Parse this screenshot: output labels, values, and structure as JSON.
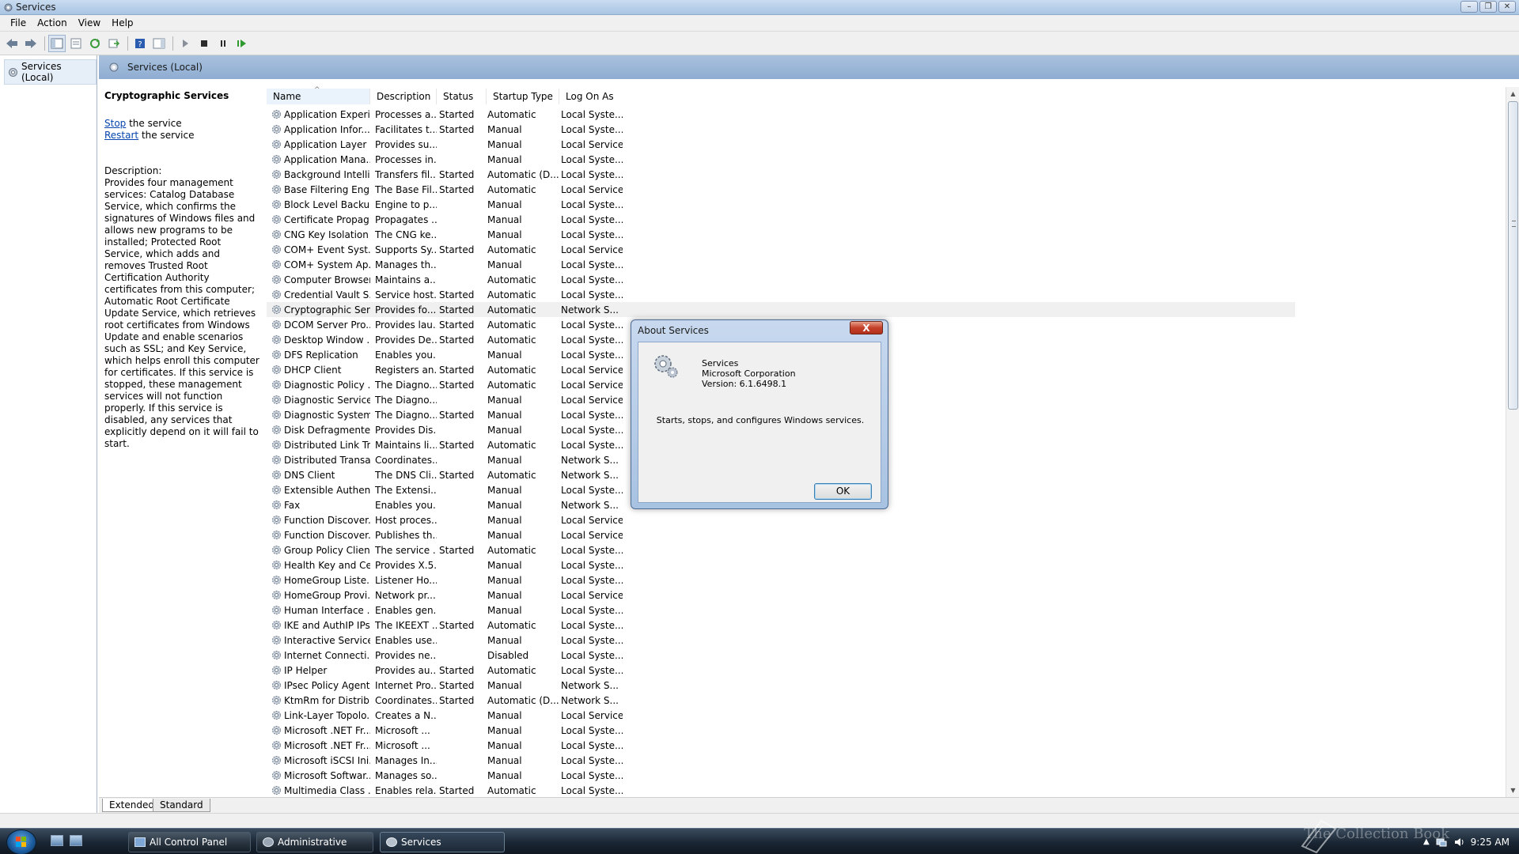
{
  "window": {
    "title": "Services"
  },
  "menu": [
    "File",
    "Action",
    "View",
    "Help"
  ],
  "tree": {
    "root": "Services (Local)"
  },
  "header": {
    "title": "Services (Local)"
  },
  "details": {
    "service_name": "Cryptographic Services",
    "stop_link": "Stop",
    "stop_suffix": " the service",
    "restart_link": "Restart",
    "restart_suffix": " the service",
    "description_label": "Description:",
    "description": "Provides four management services: Catalog Database Service, which confirms the signatures of Windows files and allows new programs to be installed; Protected Root Service, which adds and removes Trusted Root Certification Authority certificates from this computer; Automatic Root Certificate Update Service, which retrieves root certificates from Windows Update and enable scenarios such as SSL; and Key Service, which helps enroll this computer for certificates. If this service is stopped, these management services will not function properly. If this service is disabled, any services that explicitly depend on it will fail to start."
  },
  "table": {
    "columns": [
      "Name",
      "Description",
      "Status",
      "Startup Type",
      "Log On As"
    ],
    "rows": [
      [
        "Application Experi...",
        "Processes a...",
        "Started",
        "Automatic",
        "Local Syste..."
      ],
      [
        "Application Infor...",
        "Facilitates t...",
        "Started",
        "Manual",
        "Local Syste..."
      ],
      [
        "Application Layer ...",
        "Provides su...",
        "",
        "Manual",
        "Local Service"
      ],
      [
        "Application Mana...",
        "Processes in...",
        "",
        "Manual",
        "Local Syste..."
      ],
      [
        "Background Intelli...",
        "Transfers fil...",
        "Started",
        "Automatic (D...",
        "Local Syste..."
      ],
      [
        "Base Filtering Engi...",
        "The Base Fil...",
        "Started",
        "Automatic",
        "Local Service"
      ],
      [
        "Block Level Backu...",
        "Engine to p...",
        "",
        "Manual",
        "Local Syste..."
      ],
      [
        "Certificate Propag...",
        "Propagates ...",
        "",
        "Manual",
        "Local Syste..."
      ],
      [
        "CNG Key Isolation",
        "The CNG ke...",
        "",
        "Manual",
        "Local Syste..."
      ],
      [
        "COM+ Event Syst...",
        "Supports Sy...",
        "Started",
        "Automatic",
        "Local Service"
      ],
      [
        "COM+ System Ap...",
        "Manages th...",
        "",
        "Manual",
        "Local Syste..."
      ],
      [
        "Computer Browser",
        "Maintains a...",
        "",
        "Automatic",
        "Local Syste..."
      ],
      [
        "Credential Vault S...",
        "Service host...",
        "Started",
        "Automatic",
        "Local Syste..."
      ],
      [
        "Cryptographic Ser...",
        "Provides fo...",
        "Started",
        "Automatic",
        "Network S..."
      ],
      [
        "DCOM Server Pro...",
        "Provides lau...",
        "Started",
        "Automatic",
        "Local Syste..."
      ],
      [
        "Desktop Window ...",
        "Provides De...",
        "Started",
        "Automatic",
        "Local Syste..."
      ],
      [
        "DFS Replication",
        "Enables you...",
        "",
        "Manual",
        "Local Syste..."
      ],
      [
        "DHCP Client",
        "Registers an...",
        "Started",
        "Automatic",
        "Local Service"
      ],
      [
        "Diagnostic Policy ...",
        "The Diagno...",
        "Started",
        "Automatic",
        "Local Service"
      ],
      [
        "Diagnostic Service...",
        "The Diagno...",
        "",
        "Manual",
        "Local Service"
      ],
      [
        "Diagnostic System...",
        "The Diagno...",
        "Started",
        "Manual",
        "Local Syste..."
      ],
      [
        "Disk Defragmenter",
        "Provides Dis...",
        "",
        "Manual",
        "Local Syste..."
      ],
      [
        "Distributed Link Tr...",
        "Maintains li...",
        "Started",
        "Automatic",
        "Local Syste..."
      ],
      [
        "Distributed Transa...",
        "Coordinates...",
        "",
        "Manual",
        "Network S..."
      ],
      [
        "DNS Client",
        "The DNS Cli...",
        "Started",
        "Automatic",
        "Network S..."
      ],
      [
        "Extensible Authen...",
        "The Extensi...",
        "",
        "Manual",
        "Local Syste..."
      ],
      [
        "Fax",
        "Enables you...",
        "",
        "Manual",
        "Network S..."
      ],
      [
        "Function Discover...",
        "Host proces...",
        "",
        "Manual",
        "Local Service"
      ],
      [
        "Function Discover...",
        "Publishes th...",
        "",
        "Manual",
        "Local Service"
      ],
      [
        "Group Policy Client",
        "The service ...",
        "Started",
        "Automatic",
        "Local Syste..."
      ],
      [
        "Health Key and Ce...",
        "Provides X.5...",
        "",
        "Manual",
        "Local Syste..."
      ],
      [
        "HomeGroup Liste...",
        "Listener Ho...",
        "",
        "Manual",
        "Local Syste..."
      ],
      [
        "HomeGroup Provi...",
        "Network pr...",
        "",
        "Manual",
        "Local Service"
      ],
      [
        "Human Interface ...",
        "Enables gen...",
        "",
        "Manual",
        "Local Syste..."
      ],
      [
        "IKE and AuthIP IPs...",
        "The IKEEXT ...",
        "Started",
        "Automatic",
        "Local Syste..."
      ],
      [
        "Interactive Service...",
        "Enables use...",
        "",
        "Manual",
        "Local Syste..."
      ],
      [
        "Internet Connecti...",
        "Provides ne...",
        "",
        "Disabled",
        "Local Syste..."
      ],
      [
        "IP Helper",
        "Provides au...",
        "Started",
        "Automatic",
        "Local Syste..."
      ],
      [
        "IPsec Policy Agent",
        "Internet Pro...",
        "Started",
        "Manual",
        "Network S..."
      ],
      [
        "KtmRm for Distrib...",
        "Coordinates...",
        "Started",
        "Automatic (D...",
        "Network S..."
      ],
      [
        "Link-Layer Topolo...",
        "Creates a N...",
        "",
        "Manual",
        "Local Service"
      ],
      [
        "Microsoft .NET Fr...",
        "Microsoft ...",
        "",
        "Manual",
        "Local Syste..."
      ],
      [
        "Microsoft .NET Fr...",
        "Microsoft ...",
        "",
        "Manual",
        "Local Syste..."
      ],
      [
        "Microsoft iSCSI Ini...",
        "Manages In...",
        "",
        "Manual",
        "Local Syste..."
      ],
      [
        "Microsoft Softwar...",
        "Manages so...",
        "",
        "Manual",
        "Local Syste..."
      ],
      [
        "Multimedia Class ...",
        "Enables rela...",
        "Started",
        "Automatic",
        "Local Syste..."
      ]
    ],
    "selected_index": 13
  },
  "tabs": [
    "Extended",
    "Standard"
  ],
  "dialog": {
    "title": "About Services",
    "close_label": "X",
    "app_name": "Services",
    "company": "Microsoft Corporation",
    "version": "Version: 6.1.6498.1",
    "description": "Starts, stops, and configures Windows services.",
    "ok_label": "OK"
  },
  "taskbar": {
    "buttons": [
      "All Control Panel Ite...",
      "Administrative Tools",
      "Services"
    ],
    "active_index": 2,
    "clock": "9:25 AM",
    "watermark": "The Collection Book"
  },
  "icons": {
    "service": "gear-icon",
    "back": "back-arrow-icon",
    "forward": "forward-arrow-icon",
    "play": "play-icon",
    "stop": "stop-icon",
    "pause": "pause-icon",
    "resume": "resume-icon",
    "help": "help-icon"
  },
  "colors": {
    "header_band": "#9bb7d8",
    "link": "#0645ad",
    "close_red": "#c4412a"
  }
}
